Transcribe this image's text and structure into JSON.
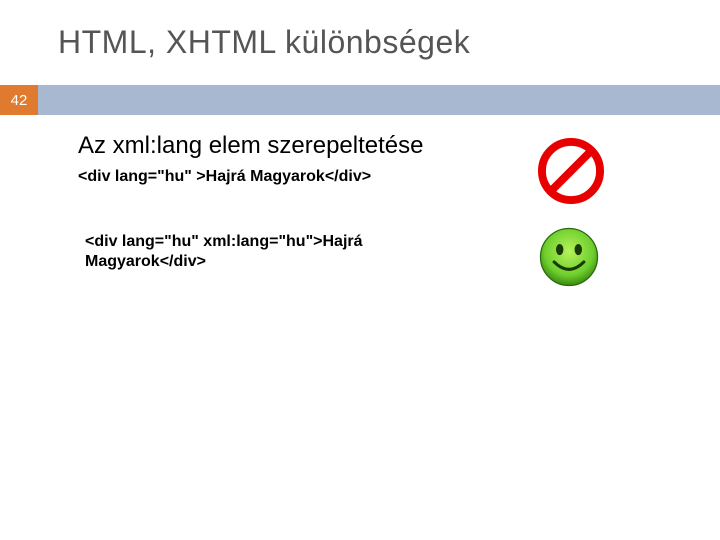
{
  "title": "HTML, XHTML különbségek",
  "page_number": "42",
  "subtitle": "Az xml:lang elem szerepeltetése",
  "code_bad": "<div lang=\"hu\" >Hajrá Magyarok</div>",
  "code_good": "<div lang=\"hu\" xml:lang=\"hu\">Hajrá Magyarok</div>",
  "icons": {
    "prohibit": "prohibit-icon",
    "smiley": "smiley-icon"
  }
}
